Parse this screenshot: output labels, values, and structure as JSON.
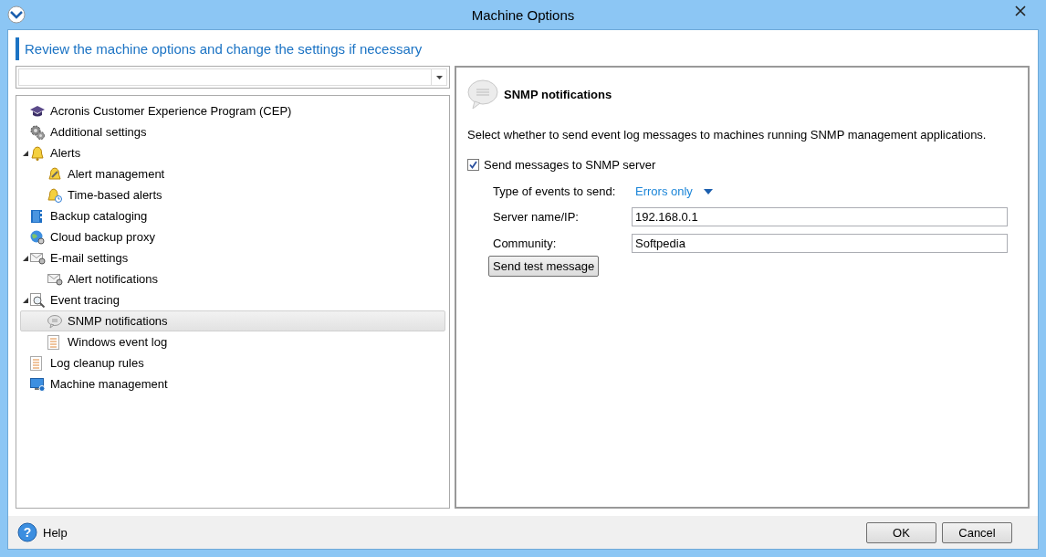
{
  "window": {
    "title": "Machine Options"
  },
  "heading": "Review the machine options and change the settings if necessary",
  "tree": [
    {
      "label": "Acronis Customer Experience Program (CEP)",
      "selected": false
    },
    {
      "label": "Additional settings",
      "selected": false
    },
    {
      "label": "Alerts",
      "selected": false,
      "expanded": true,
      "children": [
        {
          "label": "Alert management",
          "selected": false
        },
        {
          "label": "Time-based alerts",
          "selected": false
        }
      ]
    },
    {
      "label": "Backup cataloging",
      "selected": false
    },
    {
      "label": "Cloud backup proxy",
      "selected": false
    },
    {
      "label": "E-mail settings",
      "selected": false,
      "expanded": true,
      "children": [
        {
          "label": "Alert notifications",
          "selected": false
        }
      ]
    },
    {
      "label": "Event tracing",
      "selected": false,
      "expanded": true,
      "children": [
        {
          "label": "SNMP notifications",
          "selected": true
        },
        {
          "label": "Windows event log",
          "selected": false
        }
      ]
    },
    {
      "label": "Log cleanup rules",
      "selected": false
    },
    {
      "label": "Machine management",
      "selected": false
    }
  ],
  "panel": {
    "title": "SNMP notifications",
    "description": "Select whether to send event log messages to machines running SNMP management applications.",
    "send_checkbox": {
      "label": "Send messages to SNMP server",
      "checked": true
    },
    "event_type": {
      "label": "Type of events to send:",
      "value": "Errors only"
    },
    "server": {
      "label": "Server name/IP:",
      "value": "192.168.0.1"
    },
    "community": {
      "label": "Community:",
      "value": "Softpedia"
    },
    "test_button": "Send test message"
  },
  "footer": {
    "help_icon": "?",
    "help": "Help",
    "ok": "OK",
    "cancel": "Cancel"
  }
}
